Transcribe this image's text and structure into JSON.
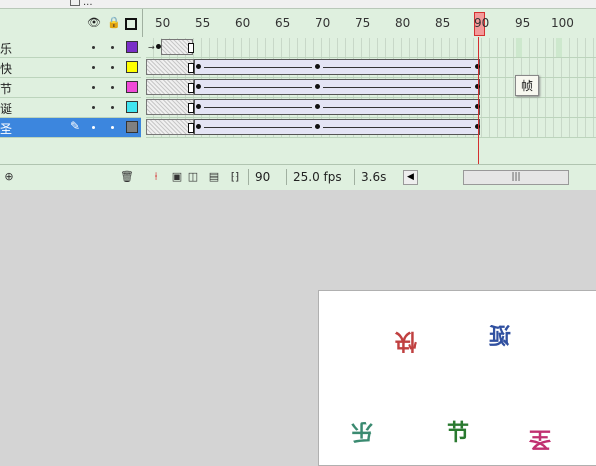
{
  "top_tab": {
    "label": "...",
    "sub": ""
  },
  "ruler": {
    "labels": [
      "50",
      "55",
      "60",
      "65",
      "70",
      "75",
      "80",
      "85",
      "90",
      "95",
      "100"
    ],
    "playhead_frame": "90"
  },
  "layers": [
    {
      "name": "乐",
      "color": "#7a2fc8",
      "selected": false
    },
    {
      "name": "快",
      "color": "#ffff00",
      "selected": false
    },
    {
      "name": "节",
      "color": "#f04ad8",
      "selected": false
    },
    {
      "name": "诞",
      "color": "#40e4f0",
      "selected": false
    },
    {
      "name": "圣",
      "color": "#808080",
      "selected": true
    }
  ],
  "icons": {
    "eye": "eye-icon",
    "lock": "lock-icon",
    "outline": "outline-square-icon",
    "add_layer": "add-layer-icon",
    "delete": "trash-icon",
    "center_frame": "center-frame-icon",
    "onion_skin": "onion-skin-icon",
    "onion_outline": "onion-skin-outline-icon",
    "edit_multiple": "edit-multiple-frames-icon",
    "modify_markers": "modify-onion-markers-icon"
  },
  "status": {
    "frame": "90",
    "fps": "25.0 fps",
    "time": "3.6s"
  },
  "tooltip": "帧",
  "canvas_glyphs": [
    {
      "char": "快",
      "color": "#c04040"
    },
    {
      "char": "诞",
      "color": "#3050a0"
    },
    {
      "char": "乐",
      "color": "#3a8a70"
    },
    {
      "char": "节",
      "color": "#2a7a30"
    },
    {
      "char": "圣",
      "color": "#c03070"
    }
  ]
}
